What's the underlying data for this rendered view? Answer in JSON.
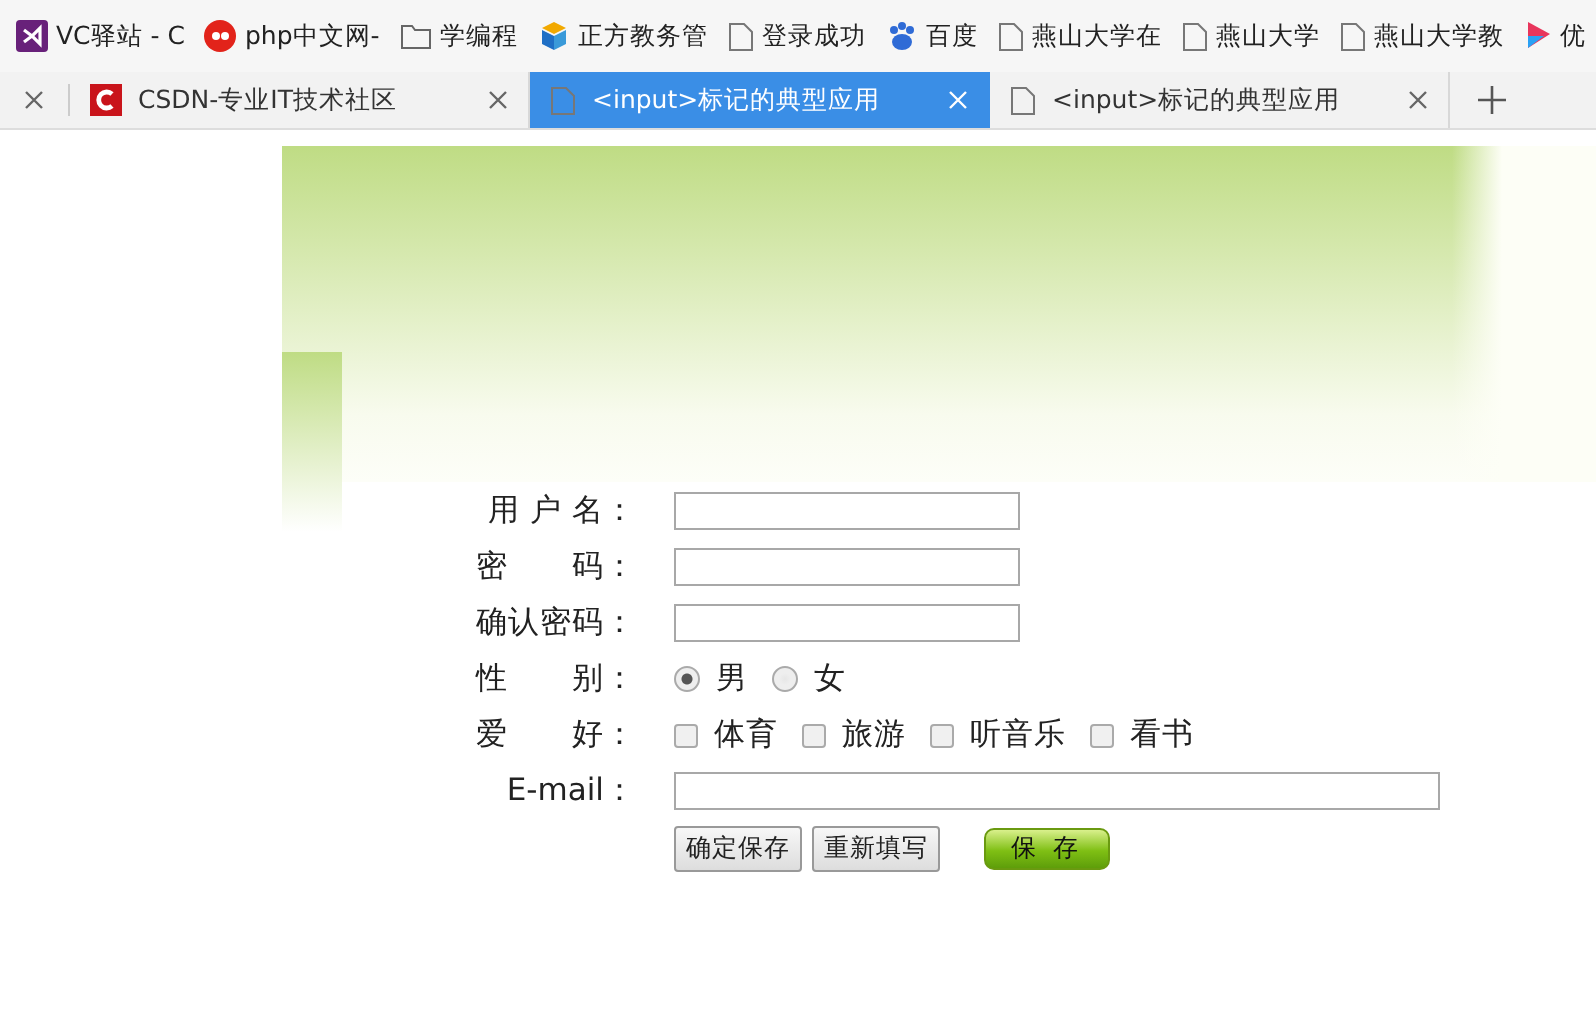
{
  "bookmarks": [
    {
      "label": "VC驿站 - C",
      "kind": "vs"
    },
    {
      "label": "php中文网-",
      "kind": "php"
    },
    {
      "label": "学编程",
      "kind": "folder"
    },
    {
      "label": "正方教务管",
      "kind": "cube"
    },
    {
      "label": "登录成功",
      "kind": "page"
    },
    {
      "label": "百度",
      "kind": "paw"
    },
    {
      "label": "燕山大学在",
      "kind": "page"
    },
    {
      "label": "燕山大学",
      "kind": "page"
    },
    {
      "label": "燕山大学教",
      "kind": "page"
    },
    {
      "label": "优",
      "kind": "play"
    }
  ],
  "tabs": [
    {
      "label": "CSDN-专业IT技术社区",
      "kind": "csdn",
      "selected": false
    },
    {
      "label": "<input>标记的典型应用",
      "kind": "page",
      "selected": true
    },
    {
      "label": "<input>标记的典型应用",
      "kind": "page",
      "selected": false
    }
  ],
  "form": {
    "rows": [
      {
        "kind": "text",
        "label": "用 户 名："
      },
      {
        "kind": "password",
        "label": "密　　码："
      },
      {
        "kind": "password",
        "label": "确认密码："
      },
      {
        "kind": "radio",
        "label": "性　　别：",
        "options": [
          {
            "label": "男",
            "selected": true
          },
          {
            "label": "女",
            "selected": false
          }
        ]
      },
      {
        "kind": "checkbox",
        "label": "爱　　好：",
        "options": [
          {
            "label": "体育",
            "checked": false
          },
          {
            "label": "旅游",
            "checked": false
          },
          {
            "label": "听音乐",
            "checked": false
          },
          {
            "label": "看书",
            "checked": false
          }
        ]
      },
      {
        "kind": "email",
        "label": "E-mail："
      }
    ],
    "buttons": [
      {
        "label": "确定保存",
        "kind": "plain"
      },
      {
        "label": "重新填写",
        "kind": "plain"
      },
      {
        "label": "保 存",
        "kind": "green"
      }
    ]
  }
}
